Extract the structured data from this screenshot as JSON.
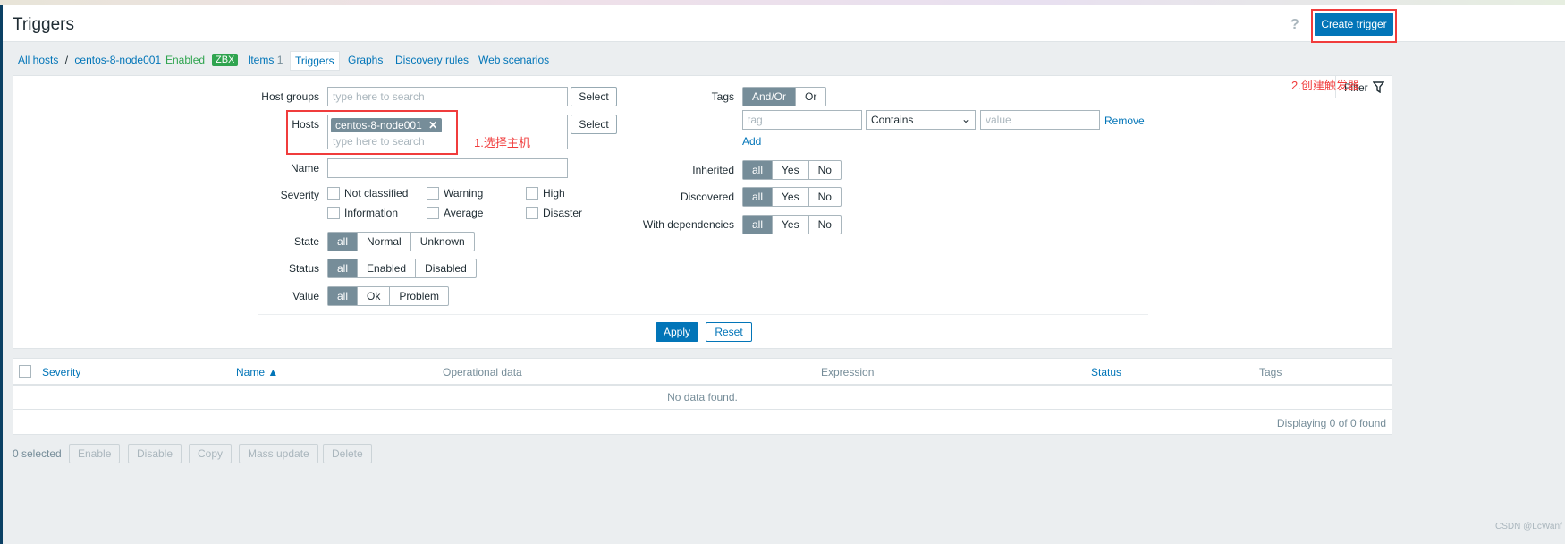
{
  "header": {
    "title": "Triggers",
    "help_icon": "?",
    "create_button": "Create trigger"
  },
  "breadcrumb": {
    "all_hosts": "All hosts",
    "separator": "/",
    "host": "centos-8-node001",
    "status": "Enabled",
    "zbx": "ZBX",
    "items": "Items",
    "items_count": "1",
    "tabs": [
      "Triggers",
      "Graphs",
      "Discovery rules",
      "Web scenarios"
    ]
  },
  "filter": {
    "tab_label": "Filter",
    "host_groups_label": "Host groups",
    "host_groups_placeholder": "type here to search",
    "select": "Select",
    "hosts_label": "Hosts",
    "hosts_chip": "centos-8-node001",
    "hosts_placeholder": "type here to search",
    "name_label": "Name",
    "name_value": "",
    "severity_label": "Severity",
    "severities": [
      "Not classified",
      "Warning",
      "High",
      "Information",
      "Average",
      "Disaster"
    ],
    "state_label": "State",
    "state_options": [
      "all",
      "Normal",
      "Unknown"
    ],
    "status_label": "Status",
    "status_options": [
      "all",
      "Enabled",
      "Disabled"
    ],
    "value_label": "Value",
    "value_options": [
      "all",
      "Ok",
      "Problem"
    ],
    "tags_label": "Tags",
    "tags_options": [
      "And/Or",
      "Or"
    ],
    "tag_placeholder": "tag",
    "tag_operator": "Contains",
    "value_placeholder": "value",
    "remove": "Remove",
    "add": "Add",
    "inherited_label": "Inherited",
    "discovered_label": "Discovered",
    "dependencies_label": "With dependencies",
    "tri_options": [
      "all",
      "Yes",
      "No"
    ],
    "apply": "Apply",
    "reset": "Reset"
  },
  "annotations": {
    "step1": "1.选择主机",
    "step2": "2.创建触发器"
  },
  "table": {
    "columns": [
      "Severity",
      "Name ▲",
      "Operational data",
      "Expression",
      "Status",
      "Tags"
    ],
    "empty": "No data found.",
    "footer": "Displaying 0 of 0 found"
  },
  "actions": {
    "selected": "0 selected",
    "buttons": [
      "Enable",
      "Disable",
      "Copy",
      "Mass update",
      "Delete"
    ]
  },
  "watermark": "CSDN @LcWanf",
  "colors": {
    "primary": "#0275b8",
    "annotation": "#f03c3c",
    "enabled": "#2fa44f"
  }
}
